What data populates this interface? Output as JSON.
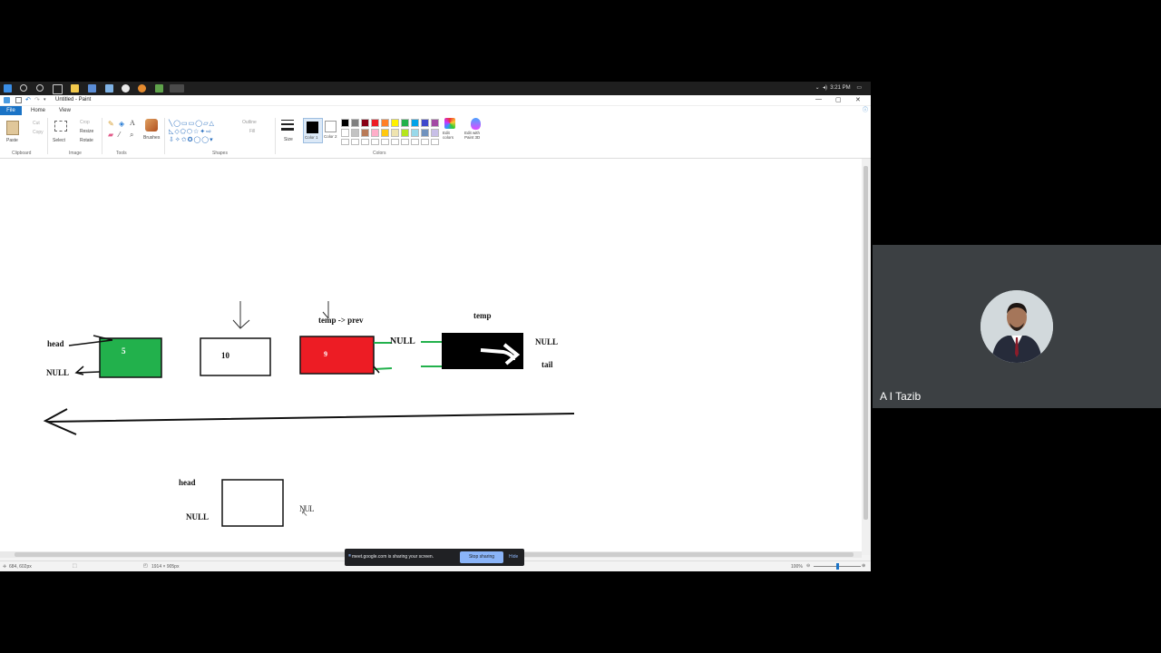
{
  "taskbar": {
    "clock": "3:21 PM"
  },
  "window": {
    "title": "Untitled - Paint"
  },
  "menu": {
    "file": "File",
    "home": "Home",
    "view": "View"
  },
  "ribbon": {
    "clipboard": {
      "paste": "Paste",
      "cut": "Cut",
      "copy": "Copy",
      "group": "Clipboard"
    },
    "image": {
      "select": "Select",
      "crop": "Crop",
      "resize": "Resize",
      "rotate": "Rotate",
      "group": "Image"
    },
    "tools": {
      "group": "Tools"
    },
    "brushes": {
      "label": "Brushes"
    },
    "shapes": {
      "outline": "Outline",
      "fill": "Fill",
      "group": "Shapes"
    },
    "size": {
      "label": "Size"
    },
    "color1": {
      "label": "Color 1",
      "value": "#000000"
    },
    "color2": {
      "label": "Color 2",
      "value": "#ffffff"
    },
    "colors": {
      "group": "Colors",
      "edit": "Edit colors",
      "paint3d": "Edit with Paint 3D"
    },
    "palette": [
      "#000000",
      "#7f7f7f",
      "#880015",
      "#ed1c24",
      "#ff7f27",
      "#fff200",
      "#22b14c",
      "#00a2e8",
      "#3f48cc",
      "#a349a4",
      "#ffffff",
      "#c3c3c3",
      "#b97a57",
      "#ffaec9",
      "#ffc90e",
      "#efe4b0",
      "#b5e61d",
      "#99d9ea",
      "#7092be",
      "#c8bfe7"
    ]
  },
  "canvas": {
    "labels": {
      "head1": "head",
      "null1": "NULL",
      "node1_value": "5",
      "node2_value": "10",
      "node3_value": "9",
      "temp_prev": "temp -> prev",
      "null_mid": "NULL",
      "temp": "temp",
      "null_right": "NULL",
      "tail": "tail",
      "head2": "head",
      "null2": "NULL",
      "scribble": "NUL"
    },
    "node_colors": {
      "node1": "#22b14c",
      "node3": "#ed1c24",
      "node4": "#000000",
      "link": "#22b14c"
    }
  },
  "status": {
    "cursor": "684, 602px",
    "canvas_size": "1914 × 905px",
    "zoom": "100%"
  },
  "share_banner": {
    "text": "meet.google.com is sharing your screen.",
    "stop": "Stop sharing",
    "hide": "Hide"
  },
  "participant": {
    "name": "A I Tazib"
  }
}
